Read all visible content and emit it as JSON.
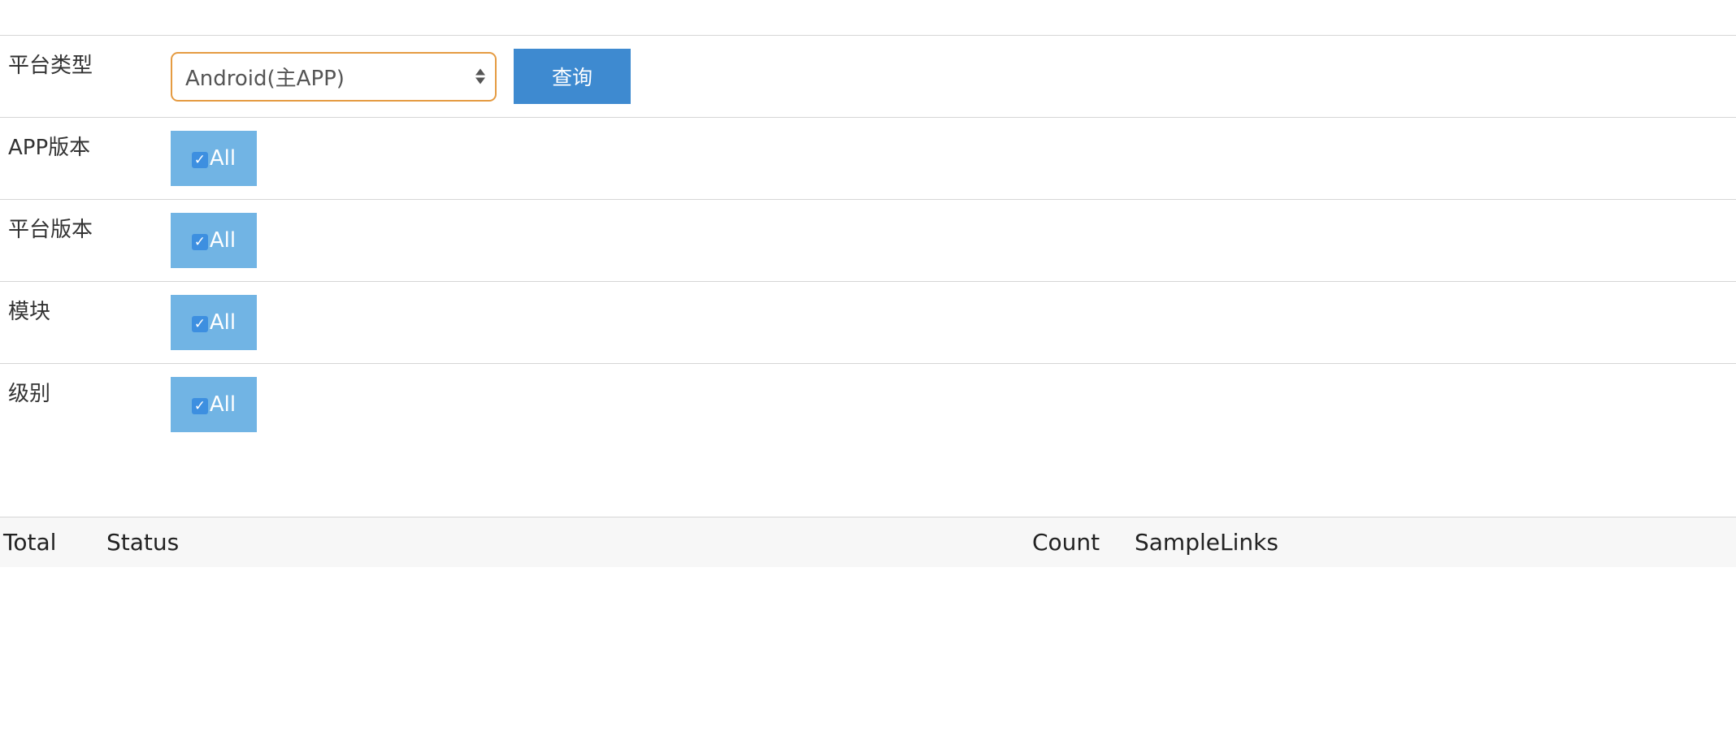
{
  "filters": {
    "platform": {
      "label": "平台类型",
      "selected": "Android(主APP)"
    },
    "query_button": "查询",
    "app_version": {
      "label": "APP版本",
      "toggle": "All"
    },
    "platform_version": {
      "label": "平台版本",
      "toggle": "All"
    },
    "module": {
      "label": "模块",
      "toggle": "All"
    },
    "level": {
      "label": "级别",
      "toggle": "All"
    },
    "check_glyph": "✓"
  },
  "results_table": {
    "columns": [
      "Total",
      "Status",
      "Count",
      "SampleLinks"
    ]
  },
  "colors": {
    "select_border": "#e59b42",
    "query_button": "#3e8ad0",
    "toggle_bg": "#71b4e4",
    "checkbox": "#3d8fe0"
  }
}
